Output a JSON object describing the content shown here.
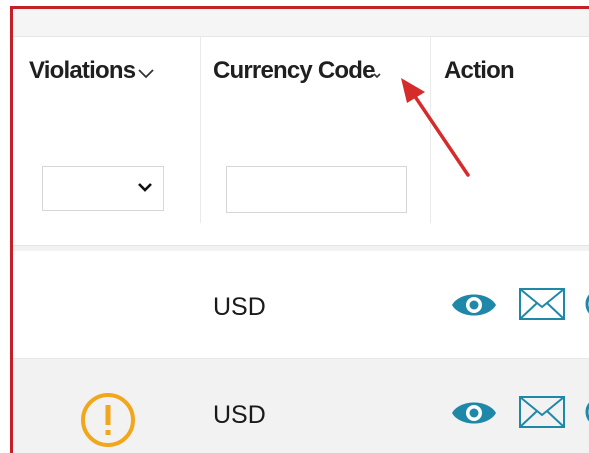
{
  "table": {
    "columns": [
      {
        "label": "Violations",
        "has_menu": true
      },
      {
        "label": "Currency Code",
        "has_menu": true
      },
      {
        "label": "Action",
        "has_menu": false
      }
    ],
    "filters": {
      "violations_select_value": "",
      "currency_code_input_value": ""
    },
    "rows": [
      {
        "violation": "",
        "currency_code": "USD",
        "actions": [
          "eye-icon",
          "envelope-icon"
        ]
      },
      {
        "violation": "warning-icon",
        "currency_code": "USD",
        "actions": [
          "eye-icon",
          "envelope-icon"
        ]
      }
    ]
  },
  "colors": {
    "frame_border": "#c3202a",
    "action_icon": "#1f88a8",
    "warning_icon": "#f2a71b",
    "annotation_arrow": "#d62b2b",
    "row_alt_bg": "#f2f2f2"
  }
}
